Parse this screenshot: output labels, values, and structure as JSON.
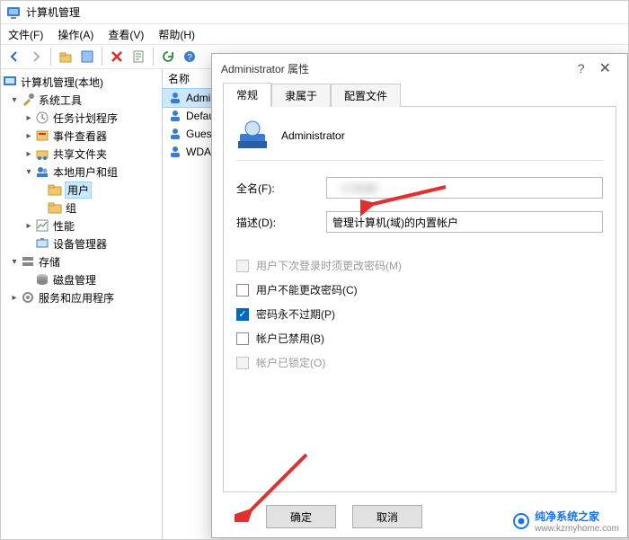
{
  "window": {
    "title": "计算机管理"
  },
  "menu": {
    "file": "文件(F)",
    "action": "操作(A)",
    "view": "查看(V)",
    "help": "帮助(H)"
  },
  "tree": {
    "root": "计算机管理(本地)",
    "system_tools": "系统工具",
    "task_scheduler": "任务计划程序",
    "event_viewer": "事件查看器",
    "shared_folders": "共享文件夹",
    "local_users": "本地用户和组",
    "users": "用户",
    "groups": "组",
    "performance": "性能",
    "device_manager": "设备管理器",
    "storage": "存储",
    "disk_mgmt": "磁盘管理",
    "services_apps": "服务和应用程序"
  },
  "list": {
    "col_name": "名称",
    "items": [
      "Admini",
      "Defau",
      "Gues",
      "WDA"
    ]
  },
  "dialog": {
    "title": "Administrator 属性",
    "tabs": {
      "general": "常规",
      "memberof": "隶属于",
      "profile": "配置文件"
    },
    "header_name": "Administrator",
    "fullname_label": "全名(F):",
    "fullname_value": "（已隐藏）",
    "desc_label": "描述(D):",
    "desc_value": "管理计算机(域)的内置帐户",
    "chk_must_change": "用户下次登录时须更改密码(M)",
    "chk_cannot_change": "用户不能更改密码(C)",
    "chk_never_expires": "密码永不过期(P)",
    "chk_disabled": "帐户已禁用(B)",
    "chk_locked": "帐户已锁定(O)",
    "btn_ok": "确定",
    "btn_cancel": "取消"
  },
  "watermark": {
    "brand": "纯净系统之家",
    "url": "www.kzmyhome.com"
  }
}
